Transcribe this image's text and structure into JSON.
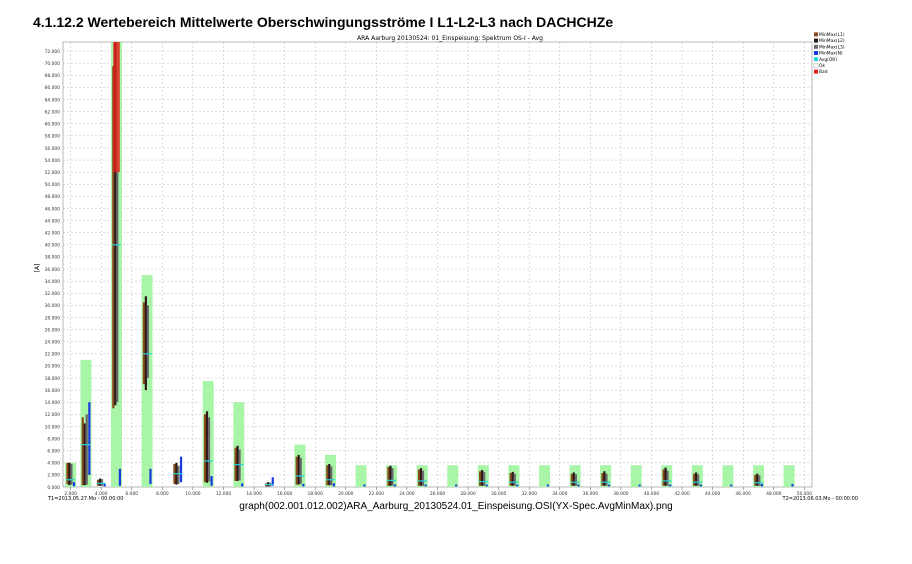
{
  "page": {
    "heading": "4.1.12.2 Wertebereich Mittelwerte Oberschwingungsströme I L1-L2-L3 nach DACHCHZe",
    "caption": "graph(002.001.012.002)ARA_Aarburg_20130524.01_Einspeisung.OSI(YX-Spec.AvgMinMax).png"
  },
  "chart_data": {
    "type": "bar",
    "title": "ARA Aarburg 20130524:  01_Einspeisung:  Spektrum   OS-I - Avg",
    "xlabel": "",
    "ylabel": "[A]",
    "xlim": [
      1.5,
      50.5
    ],
    "ylim": [
      0,
      73.5
    ],
    "xticks": [
      "2.000",
      "4.000",
      "6.000",
      "8.000",
      "10.000",
      "12.000",
      "14.000",
      "16.000",
      "18.000",
      "20.000",
      "22.000",
      "24.000",
      "26.000",
      "28.000",
      "30.000",
      "32.000",
      "34.000",
      "36.000",
      "38.000",
      "40.000",
      "42.000",
      "44.000",
      "46.000",
      "48.000",
      "50.000"
    ],
    "yticks": [
      "0.000",
      "2.000",
      "4.000",
      "6.000",
      "8.000",
      "10.000",
      "12.000",
      "14.000",
      "16.000",
      "18.000",
      "20.000",
      "22.000",
      "24.000",
      "26.000",
      "28.000",
      "30.000",
      "32.000",
      "34.000",
      "36.000",
      "38.000",
      "40.000",
      "42.000",
      "44.000",
      "46.000",
      "48.000",
      "50.000",
      "52.000",
      "54.000",
      "56.000",
      "58.000",
      "60.000",
      "62.000",
      "64.000",
      "66.000",
      "68.000",
      "70.000",
      "72.000"
    ],
    "t1_label": "T1=2013.05.27.Mo - 00:00:00",
    "t2_label": "T2=2013.06.03.Mo - 00:00:00",
    "legend": [
      "MinMax(L1)",
      "MinMax(L2)",
      "MinMax(L3)",
      "MinMax(N)",
      "Avg(OR)",
      "Ok",
      "Bad"
    ],
    "legend_colors": [
      "#8B4A1A",
      "#2a1a1a",
      "#6a6a6a",
      "#1a3adf",
      "#22d3dc",
      "#ffffff",
      "#e0201a"
    ],
    "limit_color": "#a8f5a8",
    "grid": true,
    "limits": [
      {
        "order": 2,
        "value": 4.0
      },
      {
        "order": 3,
        "value": 21.0
      },
      {
        "order": 5,
        "value": 73.5
      },
      {
        "order": 7,
        "value": 35.0
      },
      {
        "order": 11,
        "value": 17.5
      },
      {
        "order": 13,
        "value": 14.0
      },
      {
        "order": 17,
        "value": 7.0
      },
      {
        "order": 19,
        "value": 5.3
      },
      {
        "order": 21,
        "value": 3.6
      },
      {
        "order": 23,
        "value": 3.6
      },
      {
        "order": 25,
        "value": 3.6
      },
      {
        "order": 27,
        "value": 3.6
      },
      {
        "order": 29,
        "value": 3.6
      },
      {
        "order": 31,
        "value": 3.6
      },
      {
        "order": 33,
        "value": 3.6
      },
      {
        "order": 35,
        "value": 3.6
      },
      {
        "order": 37,
        "value": 3.6
      },
      {
        "order": 39,
        "value": 3.6
      },
      {
        "order": 41,
        "value": 3.6
      },
      {
        "order": 43,
        "value": 3.6
      },
      {
        "order": 45,
        "value": 3.6
      },
      {
        "order": 47,
        "value": 3.6
      },
      {
        "order": 49,
        "value": 3.6
      }
    ],
    "series": [
      {
        "name": "MinMax(L1)",
        "values": [
          {
            "order": 2,
            "min": 0.5,
            "max": 4.0
          },
          {
            "order": 3,
            "min": 0.3,
            "max": 11.5
          },
          {
            "order": 4,
            "min": 0.2,
            "max": 1.2
          },
          {
            "order": 5,
            "min": 13.0,
            "max": 69.5
          },
          {
            "order": 7,
            "min": 17.0,
            "max": 30.5
          },
          {
            "order": 9,
            "min": 0.5,
            "max": 3.8
          },
          {
            "order": 11,
            "min": 0.8,
            "max": 12.0
          },
          {
            "order": 13,
            "min": 1.0,
            "max": 6.5
          },
          {
            "order": 15,
            "min": 0.1,
            "max": 0.6
          },
          {
            "order": 17,
            "min": 0.4,
            "max": 5.0
          },
          {
            "order": 19,
            "min": 0.3,
            "max": 3.6
          },
          {
            "order": 23,
            "min": 0.2,
            "max": 3.3
          },
          {
            "order": 25,
            "min": 0.2,
            "max": 2.9
          },
          {
            "order": 29,
            "min": 0.2,
            "max": 2.6
          },
          {
            "order": 31,
            "min": 0.2,
            "max": 2.3
          },
          {
            "order": 35,
            "min": 0.2,
            "max": 2.2
          },
          {
            "order": 37,
            "min": 0.2,
            "max": 2.3
          },
          {
            "order": 41,
            "min": 0.2,
            "max": 2.9
          },
          {
            "order": 43,
            "min": 0.2,
            "max": 2.2
          },
          {
            "order": 47,
            "min": 0.2,
            "max": 2.0
          }
        ]
      },
      {
        "name": "MinMax(L2)",
        "values": [
          {
            "order": 2,
            "min": 0.3,
            "max": 4.0
          },
          {
            "order": 3,
            "min": 0.3,
            "max": 10.5
          },
          {
            "order": 4,
            "min": 0.2,
            "max": 1.4
          },
          {
            "order": 5,
            "min": 13.5,
            "max": 73.5
          },
          {
            "order": 7,
            "min": 16.0,
            "max": 31.5
          },
          {
            "order": 9,
            "min": 0.4,
            "max": 4.0
          },
          {
            "order": 11,
            "min": 0.7,
            "max": 12.5
          },
          {
            "order": 13,
            "min": 1.0,
            "max": 6.8
          },
          {
            "order": 15,
            "min": 0.1,
            "max": 0.8
          },
          {
            "order": 17,
            "min": 0.4,
            "max": 5.3
          },
          {
            "order": 19,
            "min": 0.3,
            "max": 3.8
          },
          {
            "order": 23,
            "min": 0.2,
            "max": 3.5
          },
          {
            "order": 25,
            "min": 0.2,
            "max": 3.1
          },
          {
            "order": 29,
            "min": 0.2,
            "max": 2.8
          },
          {
            "order": 31,
            "min": 0.2,
            "max": 2.5
          },
          {
            "order": 35,
            "min": 0.2,
            "max": 2.4
          },
          {
            "order": 37,
            "min": 0.2,
            "max": 2.6
          },
          {
            "order": 41,
            "min": 0.2,
            "max": 3.2
          },
          {
            "order": 43,
            "min": 0.2,
            "max": 2.4
          },
          {
            "order": 47,
            "min": 0.2,
            "max": 2.2
          }
        ]
      },
      {
        "name": "MinMax(L3)",
        "values": [
          {
            "order": 2,
            "min": 0.4,
            "max": 3.8
          },
          {
            "order": 3,
            "min": 0.4,
            "max": 12.0
          },
          {
            "order": 4,
            "min": 0.2,
            "max": 1.3
          },
          {
            "order": 5,
            "min": 14.0,
            "max": 52.0
          },
          {
            "order": 7,
            "min": 18.0,
            "max": 30.0
          },
          {
            "order": 9,
            "min": 0.5,
            "max": 3.5
          },
          {
            "order": 11,
            "min": 0.9,
            "max": 11.5
          },
          {
            "order": 13,
            "min": 1.1,
            "max": 6.2
          },
          {
            "order": 15,
            "min": 0.1,
            "max": 0.7
          },
          {
            "order": 17,
            "min": 0.5,
            "max": 4.8
          },
          {
            "order": 19,
            "min": 0.3,
            "max": 3.4
          },
          {
            "order": 23,
            "min": 0.2,
            "max": 3.1
          },
          {
            "order": 25,
            "min": 0.2,
            "max": 2.7
          },
          {
            "order": 29,
            "min": 0.2,
            "max": 2.5
          },
          {
            "order": 31,
            "min": 0.2,
            "max": 2.2
          },
          {
            "order": 35,
            "min": 0.2,
            "max": 2.1
          },
          {
            "order": 37,
            "min": 0.2,
            "max": 2.2
          },
          {
            "order": 41,
            "min": 0.2,
            "max": 2.7
          },
          {
            "order": 43,
            "min": 0.2,
            "max": 2.1
          },
          {
            "order": 47,
            "min": 0.2,
            "max": 1.9
          }
        ]
      },
      {
        "name": "MinMax(N)",
        "values": [
          {
            "order": 2,
            "min": 0.1,
            "max": 0.8
          },
          {
            "order": 3,
            "min": 2.0,
            "max": 14.0
          },
          {
            "order": 4,
            "min": 0.1,
            "max": 0.5
          },
          {
            "order": 5,
            "min": 0.2,
            "max": 3.0
          },
          {
            "order": 7,
            "min": 0.5,
            "max": 3.0
          },
          {
            "order": 9,
            "min": 0.8,
            "max": 5.0
          },
          {
            "order": 11,
            "min": 0.2,
            "max": 1.8
          },
          {
            "order": 13,
            "min": 0.1,
            "max": 0.6
          },
          {
            "order": 15,
            "min": 0.2,
            "max": 1.6
          },
          {
            "order": 17,
            "min": 0.1,
            "max": 0.5
          },
          {
            "order": 19,
            "min": 0.1,
            "max": 0.6
          },
          {
            "order": 21,
            "min": 0.1,
            "max": 0.4
          },
          {
            "order": 23,
            "min": 0.1,
            "max": 0.4
          },
          {
            "order": 25,
            "min": 0.1,
            "max": 0.4
          },
          {
            "order": 27,
            "min": 0.1,
            "max": 0.4
          },
          {
            "order": 29,
            "min": 0.1,
            "max": 0.4
          },
          {
            "order": 31,
            "min": 0.1,
            "max": 0.4
          },
          {
            "order": 33,
            "min": 0.1,
            "max": 0.4
          },
          {
            "order": 35,
            "min": 0.1,
            "max": 0.4
          },
          {
            "order": 37,
            "min": 0.1,
            "max": 0.4
          },
          {
            "order": 39,
            "min": 0.1,
            "max": 0.4
          },
          {
            "order": 41,
            "min": 0.1,
            "max": 0.4
          },
          {
            "order": 43,
            "min": 0.1,
            "max": 0.4
          },
          {
            "order": 45,
            "min": 0.1,
            "max": 0.4
          },
          {
            "order": 47,
            "min": 0.1,
            "max": 0.5
          },
          {
            "order": 49,
            "min": 0.1,
            "max": 0.5
          }
        ]
      },
      {
        "name": "Avg(OR)",
        "values": [
          {
            "order": 2,
            "value": 1.2
          },
          {
            "order": 3,
            "value": 7.0
          },
          {
            "order": 4,
            "value": 0.6
          },
          {
            "order": 5,
            "value": 40.0
          },
          {
            "order": 7,
            "value": 22.0
          },
          {
            "order": 9,
            "value": 2.2
          },
          {
            "order": 11,
            "value": 4.3
          },
          {
            "order": 13,
            "value": 3.7
          },
          {
            "order": 15,
            "value": 0.4
          },
          {
            "order": 17,
            "value": 1.8
          },
          {
            "order": 19,
            "value": 1.2
          },
          {
            "order": 23,
            "value": 1.1
          },
          {
            "order": 25,
            "value": 1.0
          },
          {
            "order": 29,
            "value": 0.9
          },
          {
            "order": 31,
            "value": 0.8
          },
          {
            "order": 35,
            "value": 0.8
          },
          {
            "order": 37,
            "value": 0.8
          },
          {
            "order": 41,
            "value": 1.0
          },
          {
            "order": 43,
            "value": 0.8
          },
          {
            "order": 47,
            "value": 0.7
          }
        ]
      },
      {
        "name": "Bad",
        "values": [
          {
            "order": 5,
            "min": 52.0,
            "max": 73.5
          }
        ]
      }
    ]
  }
}
